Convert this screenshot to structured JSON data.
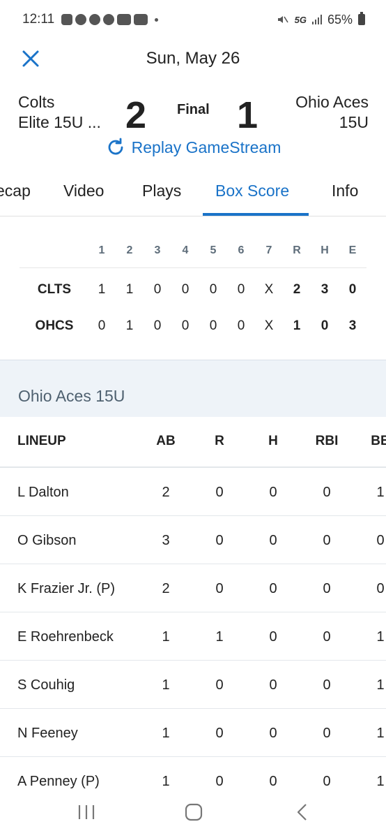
{
  "status_bar": {
    "time": "12:11",
    "network": "5G",
    "battery": "65%",
    "icons": [
      "instagram-icon",
      "messenger-icon",
      "pinterest-icon",
      "pinterest-icon",
      "youtube-icon",
      "youtube-icon"
    ]
  },
  "header": {
    "date": "Sun, May 26",
    "home_team_line1": "Colts",
    "home_team_line2": "Elite 15U ...",
    "home_score": "2",
    "status": "Final",
    "away_score": "1",
    "away_team_line1": "Ohio Aces",
    "away_team_line2": "15U",
    "replay_label": "Replay GameStream"
  },
  "tabs": [
    {
      "label": "ecap",
      "active": false
    },
    {
      "label": "Video",
      "active": false
    },
    {
      "label": "Plays",
      "active": false
    },
    {
      "label": "Box Score",
      "active": true
    },
    {
      "label": "Info",
      "active": false
    }
  ],
  "linescore": {
    "headers": [
      "1",
      "2",
      "3",
      "4",
      "5",
      "6",
      "7",
      "R",
      "H",
      "E"
    ],
    "rows": [
      {
        "team": "CLTS",
        "innings": [
          "1",
          "1",
          "0",
          "0",
          "0",
          "0",
          "X"
        ],
        "totals": [
          "2",
          "3",
          "0"
        ]
      },
      {
        "team": "OHCS",
        "innings": [
          "0",
          "1",
          "0",
          "0",
          "0",
          "0",
          "X"
        ],
        "totals": [
          "1",
          "0",
          "3"
        ]
      }
    ]
  },
  "section_title": "Ohio Aces 15U",
  "lineup": {
    "headers": [
      "LINEUP",
      "AB",
      "R",
      "H",
      "RBI",
      "BB"
    ],
    "rows": [
      {
        "name": "L Dalton",
        "ab": "2",
        "r": "0",
        "h": "0",
        "rbi": "0",
        "bb": "1"
      },
      {
        "name": "O Gibson",
        "ab": "3",
        "r": "0",
        "h": "0",
        "rbi": "0",
        "bb": "0"
      },
      {
        "name": "K Frazier Jr. (P)",
        "ab": "2",
        "r": "0",
        "h": "0",
        "rbi": "0",
        "bb": "0"
      },
      {
        "name": "E Roehrenbeck",
        "ab": "1",
        "r": "1",
        "h": "0",
        "rbi": "0",
        "bb": "1"
      },
      {
        "name": "S Couhig",
        "ab": "1",
        "r": "0",
        "h": "0",
        "rbi": "0",
        "bb": "1"
      },
      {
        "name": "N Feeney",
        "ab": "1",
        "r": "0",
        "h": "0",
        "rbi": "0",
        "bb": "1"
      },
      {
        "name": "A Penney (P)",
        "ab": "1",
        "r": "0",
        "h": "0",
        "rbi": "0",
        "bb": "1"
      }
    ]
  },
  "colors": {
    "accent": "#1a73c8",
    "section_band": "#eef3f8",
    "muted_text": "#5e6d7a"
  }
}
